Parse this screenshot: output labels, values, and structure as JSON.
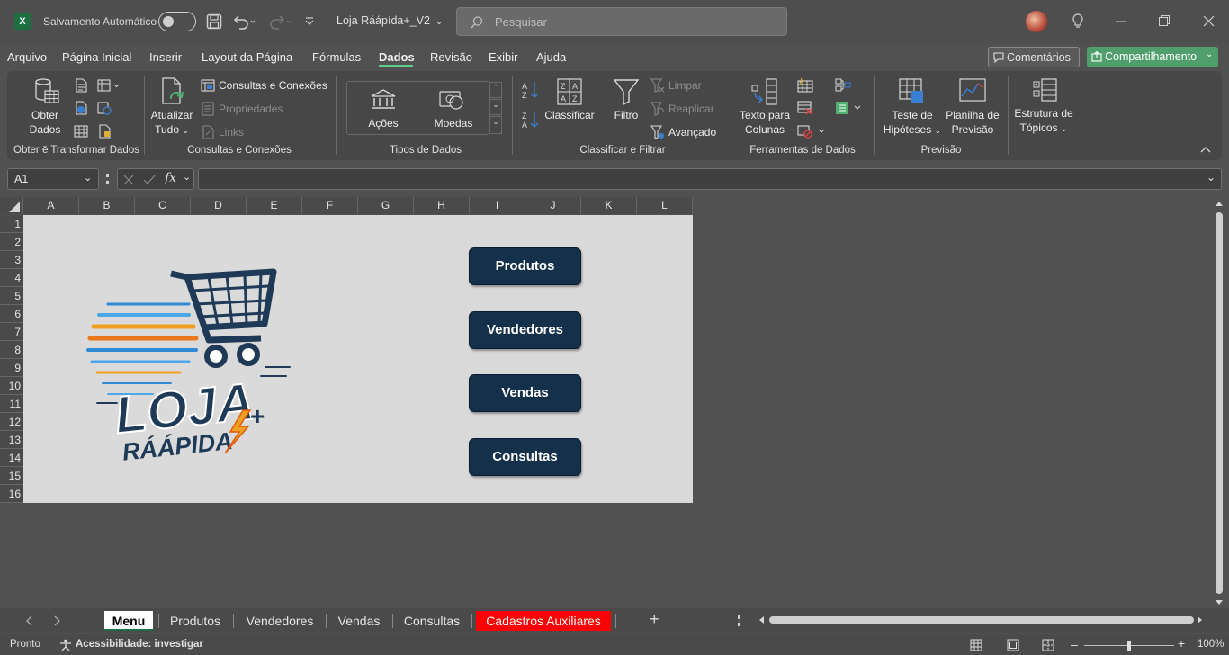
{
  "titlebar": {
    "app_icon": "X",
    "autosave_label": "Salvamento Automático",
    "filename": "Loja Ráápída+_V2",
    "search_placeholder": "Pesquisar"
  },
  "menu": {
    "items": [
      "Arquivo",
      "Página Inicial",
      "Inserir",
      "Layout da Página",
      "Fórmulas",
      "Dados",
      "Revisão",
      "Exibir",
      "Ajuda"
    ],
    "active": "Dados",
    "comments_label": "Comentários",
    "share_label": "Compartilhamento"
  },
  "ribbon": {
    "groups": {
      "get_transform": "Obter e Transformar Dados",
      "queries": "Consultas e Conexões",
      "data_types": "Tipos de Dados",
      "sort_filter": "Classificar e Filtrar",
      "data_tools": "Ferramentas de Dados",
      "forecast": "Previsão",
      "outline": ""
    },
    "get_data_l1": "Obter",
    "get_data_l2": "Dados",
    "refresh_l1": "Atualizar",
    "refresh_l2": "Tudo",
    "queries_connections": "Consultas e Conexões",
    "properties": "Propriedades",
    "links": "Links",
    "stocks": "Ações",
    "currencies": "Moedas",
    "sort": "Classificar",
    "filter": "Filtro",
    "clear": "Limpar",
    "reapply": "Reaplicar",
    "advanced": "Avançado",
    "text_to_cols_l1": "Texto para",
    "text_to_cols_l2": "Colunas",
    "whatif_l1": "Teste de",
    "whatif_l2": "Hipóteses",
    "forecast_sheet_l1": "Planilha de",
    "forecast_sheet_l2": "Previsão",
    "outline_l1": "Estrutura de",
    "outline_l2": "Tópicos"
  },
  "formula_bar": {
    "name_box": "A1",
    "fx": "fx",
    "formula": ""
  },
  "grid": {
    "columns": [
      "A",
      "B",
      "C",
      "D",
      "E",
      "F",
      "G",
      "H",
      "I",
      "J",
      "K",
      "L"
    ],
    "rows": [
      "1",
      "2",
      "3",
      "4",
      "5",
      "6",
      "7",
      "8",
      "9",
      "10",
      "11",
      "12",
      "13",
      "14",
      "15",
      "16"
    ]
  },
  "sheet_content": {
    "logo_line1": "LOJA",
    "logo_line2": "RÁÁPIDA",
    "logo_plus": "+",
    "buttons": [
      "Produtos",
      "Vendedores",
      "Vendas",
      "Consultas"
    ]
  },
  "tabs": {
    "items": [
      "Menu",
      "Produtos",
      "Vendedores",
      "Vendas",
      "Consultas",
      "Cadastros Auxiliares"
    ],
    "active": "Menu",
    "highlight_color": "#ff0000",
    "add": "+"
  },
  "status": {
    "ready": "Pronto",
    "accessibility": "Acessibilidade: investigar",
    "zoom": "100%"
  },
  "colors": {
    "background": "#515151",
    "sheet_bg": "#d9d9d9",
    "button_bg": "#15304a",
    "accent": "#5fd08c"
  }
}
